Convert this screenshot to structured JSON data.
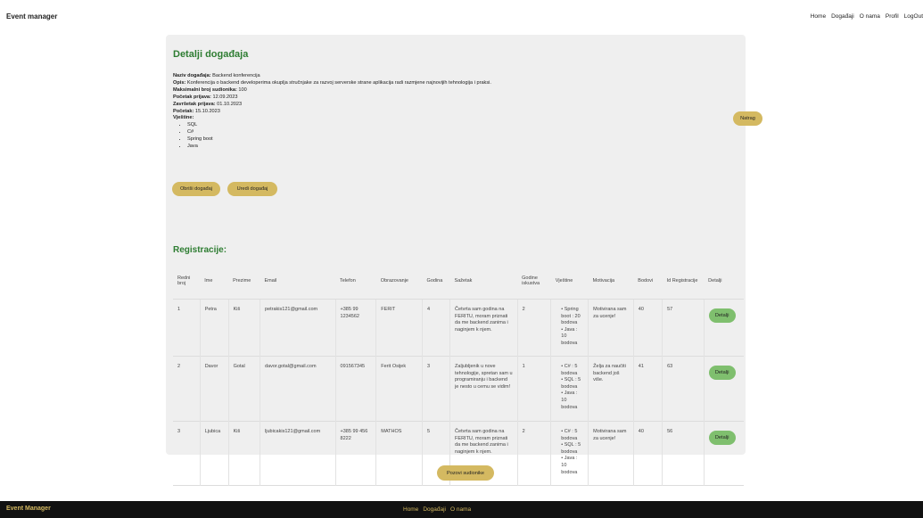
{
  "header": {
    "brand": "Event manager",
    "nav": [
      "Home",
      "Događaji",
      "O nama",
      "Profil",
      "LogOut"
    ]
  },
  "event": {
    "title": "Detalji događaja",
    "fields": [
      {
        "label": "Naziv događaja:",
        "value": "Backend konferencija"
      },
      {
        "label": "Opis:",
        "value": "Konferencija o backend developerima okuplja stručnjake za razvoj serverske strane aplikacija radi razmjene najnovijih tehnologija i praksi."
      },
      {
        "label": "Maksimalni broj sudionika:",
        "value": "100"
      },
      {
        "label": "Početak prijava:",
        "value": "12.09.2023"
      },
      {
        "label": "Završetak prijava:",
        "value": "01.10.2023"
      },
      {
        "label": "Početak:",
        "value": "15.10.2023"
      }
    ],
    "skills_label": "Vještine:",
    "skills": [
      "SQL",
      "C#",
      "Spring boot",
      "Java"
    ],
    "back_label": "Natrag",
    "delete_label": "Obriši događaj",
    "edit_label": "Uredi događaj"
  },
  "registrations": {
    "title": "Registracije:",
    "columns": [
      "Redni broj",
      "Ime",
      "Prezime",
      "Email",
      "Telefon",
      "Obrazovanje",
      "Godina",
      "Sažetak",
      "Godine iskustva",
      "Vještine",
      "Motivacija",
      "Bodovi",
      "Id Registracije",
      "Detalji"
    ],
    "rows": [
      {
        "redni": "1",
        "ime": "Petra",
        "prezime": "Kiš",
        "email": "petrakis121@gmail.com",
        "telefon": "+385 99 1234562",
        "obrazovanje": "FERIT",
        "godina": "4",
        "sazetak": "Četvrta sam godina na FERITU, moram priznati da me backend zanima i naginjem k njem.",
        "iskustvo": "2",
        "vjestine": [
          "Spring boot : 20 bodova",
          "Java : 10 bodova"
        ],
        "motivacija": "Motivirana sam za ucenje!",
        "bodovi": "40",
        "id": "57",
        "detalji": "Detalji"
      },
      {
        "redni": "2",
        "ime": "Davor",
        "prezime": "Gotal",
        "email": "davor.gotal@gmail.com",
        "telefon": "091567345",
        "obrazovanje": "Ferit Osijek",
        "godina": "3",
        "sazetak": "Zaljubljenik u nove tehnologije, spretan sam u programiranju i backend je nesto u cemu se vidim!",
        "iskustvo": "1",
        "vjestine": [
          "C# : 5 bodova",
          "SQL : 5 bodova",
          "Java : 10 bodova"
        ],
        "motivacija": "Želja za naučiti backend još više.",
        "bodovi": "41",
        "id": "63",
        "detalji": "Detalji"
      },
      {
        "redni": "3",
        "ime": "Ljubica",
        "prezime": "Kiš",
        "email": "ljubicakis121@gmail.com",
        "telefon": "+385 99 456 8222",
        "obrazovanje": "MATHOS",
        "godina": "5",
        "sazetak": "Četvrta sam godina na FERITU, moram priznati da me backend zanima i naginjem k njem.",
        "iskustvo": "2",
        "vjestine": [
          "C# : 5 bodova",
          "SQL : 5 bodova",
          "Java : 10 bodova"
        ],
        "motivacija": "Motivirana sam za ucenje!",
        "bodovi": "40",
        "id": "56",
        "detalji": "Detalji"
      }
    ]
  },
  "invite_label": "Pozovi sudionike",
  "footer": {
    "brand": "Event Manager",
    "nav": [
      "Home",
      "Događaji",
      "O nama"
    ]
  }
}
